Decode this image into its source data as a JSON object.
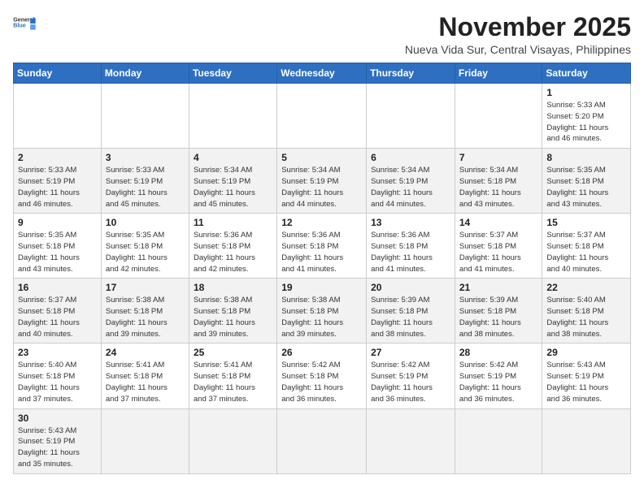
{
  "header": {
    "logo_line1": "General",
    "logo_line2": "Blue",
    "month_title": "November 2025",
    "location": "Nueva Vida Sur, Central Visayas, Philippines"
  },
  "weekdays": [
    "Sunday",
    "Monday",
    "Tuesday",
    "Wednesday",
    "Thursday",
    "Friday",
    "Saturday"
  ],
  "weeks": [
    [
      {
        "day": "",
        "info": ""
      },
      {
        "day": "",
        "info": ""
      },
      {
        "day": "",
        "info": ""
      },
      {
        "day": "",
        "info": ""
      },
      {
        "day": "",
        "info": ""
      },
      {
        "day": "",
        "info": ""
      },
      {
        "day": "1",
        "info": "Sunrise: 5:33 AM\nSunset: 5:20 PM\nDaylight: 11 hours\nand 46 minutes."
      }
    ],
    [
      {
        "day": "2",
        "info": "Sunrise: 5:33 AM\nSunset: 5:19 PM\nDaylight: 11 hours\nand 46 minutes."
      },
      {
        "day": "3",
        "info": "Sunrise: 5:33 AM\nSunset: 5:19 PM\nDaylight: 11 hours\nand 45 minutes."
      },
      {
        "day": "4",
        "info": "Sunrise: 5:34 AM\nSunset: 5:19 PM\nDaylight: 11 hours\nand 45 minutes."
      },
      {
        "day": "5",
        "info": "Sunrise: 5:34 AM\nSunset: 5:19 PM\nDaylight: 11 hours\nand 44 minutes."
      },
      {
        "day": "6",
        "info": "Sunrise: 5:34 AM\nSunset: 5:19 PM\nDaylight: 11 hours\nand 44 minutes."
      },
      {
        "day": "7",
        "info": "Sunrise: 5:34 AM\nSunset: 5:18 PM\nDaylight: 11 hours\nand 43 minutes."
      },
      {
        "day": "8",
        "info": "Sunrise: 5:35 AM\nSunset: 5:18 PM\nDaylight: 11 hours\nand 43 minutes."
      }
    ],
    [
      {
        "day": "9",
        "info": "Sunrise: 5:35 AM\nSunset: 5:18 PM\nDaylight: 11 hours\nand 43 minutes."
      },
      {
        "day": "10",
        "info": "Sunrise: 5:35 AM\nSunset: 5:18 PM\nDaylight: 11 hours\nand 42 minutes."
      },
      {
        "day": "11",
        "info": "Sunrise: 5:36 AM\nSunset: 5:18 PM\nDaylight: 11 hours\nand 42 minutes."
      },
      {
        "day": "12",
        "info": "Sunrise: 5:36 AM\nSunset: 5:18 PM\nDaylight: 11 hours\nand 41 minutes."
      },
      {
        "day": "13",
        "info": "Sunrise: 5:36 AM\nSunset: 5:18 PM\nDaylight: 11 hours\nand 41 minutes."
      },
      {
        "day": "14",
        "info": "Sunrise: 5:37 AM\nSunset: 5:18 PM\nDaylight: 11 hours\nand 41 minutes."
      },
      {
        "day": "15",
        "info": "Sunrise: 5:37 AM\nSunset: 5:18 PM\nDaylight: 11 hours\nand 40 minutes."
      }
    ],
    [
      {
        "day": "16",
        "info": "Sunrise: 5:37 AM\nSunset: 5:18 PM\nDaylight: 11 hours\nand 40 minutes."
      },
      {
        "day": "17",
        "info": "Sunrise: 5:38 AM\nSunset: 5:18 PM\nDaylight: 11 hours\nand 39 minutes."
      },
      {
        "day": "18",
        "info": "Sunrise: 5:38 AM\nSunset: 5:18 PM\nDaylight: 11 hours\nand 39 minutes."
      },
      {
        "day": "19",
        "info": "Sunrise: 5:38 AM\nSunset: 5:18 PM\nDaylight: 11 hours\nand 39 minutes."
      },
      {
        "day": "20",
        "info": "Sunrise: 5:39 AM\nSunset: 5:18 PM\nDaylight: 11 hours\nand 38 minutes."
      },
      {
        "day": "21",
        "info": "Sunrise: 5:39 AM\nSunset: 5:18 PM\nDaylight: 11 hours\nand 38 minutes."
      },
      {
        "day": "22",
        "info": "Sunrise: 5:40 AM\nSunset: 5:18 PM\nDaylight: 11 hours\nand 38 minutes."
      }
    ],
    [
      {
        "day": "23",
        "info": "Sunrise: 5:40 AM\nSunset: 5:18 PM\nDaylight: 11 hours\nand 37 minutes."
      },
      {
        "day": "24",
        "info": "Sunrise: 5:41 AM\nSunset: 5:18 PM\nDaylight: 11 hours\nand 37 minutes."
      },
      {
        "day": "25",
        "info": "Sunrise: 5:41 AM\nSunset: 5:18 PM\nDaylight: 11 hours\nand 37 minutes."
      },
      {
        "day": "26",
        "info": "Sunrise: 5:42 AM\nSunset: 5:18 PM\nDaylight: 11 hours\nand 36 minutes."
      },
      {
        "day": "27",
        "info": "Sunrise: 5:42 AM\nSunset: 5:19 PM\nDaylight: 11 hours\nand 36 minutes."
      },
      {
        "day": "28",
        "info": "Sunrise: 5:42 AM\nSunset: 5:19 PM\nDaylight: 11 hours\nand 36 minutes."
      },
      {
        "day": "29",
        "info": "Sunrise: 5:43 AM\nSunset: 5:19 PM\nDaylight: 11 hours\nand 36 minutes."
      }
    ],
    [
      {
        "day": "30",
        "info": "Sunrise: 5:43 AM\nSunset: 5:19 PM\nDaylight: 11 hours\nand 35 minutes."
      },
      {
        "day": "",
        "info": ""
      },
      {
        "day": "",
        "info": ""
      },
      {
        "day": "",
        "info": ""
      },
      {
        "day": "",
        "info": ""
      },
      {
        "day": "",
        "info": ""
      },
      {
        "day": "",
        "info": ""
      }
    ]
  ]
}
